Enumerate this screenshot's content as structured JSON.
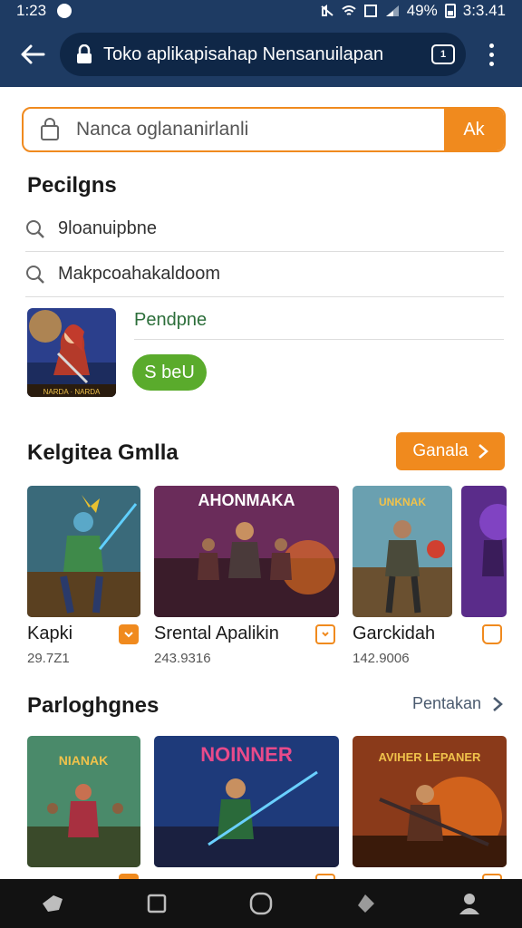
{
  "status_bar": {
    "time": "1:23",
    "battery": "49%",
    "clock": "3:3.41"
  },
  "browser": {
    "url_title": "Toko aplikapisahap Nensanuilapan",
    "tab_count": "1"
  },
  "search": {
    "placeholder": "Nanca oglananirlanli",
    "button_label": "Ak"
  },
  "suggestions": {
    "title": "Pecilgns",
    "items": [
      {
        "label": "9loanuipbne"
      },
      {
        "label": "Makpcoahakaldoom"
      }
    ],
    "featured": {
      "name": "Pendpne",
      "button_label": "S beU",
      "thumb_text": "NARDA · NARDA"
    }
  },
  "categories": {
    "title": "Kelgitea Gmlla",
    "see_all": "Ganala",
    "cards": [
      {
        "name": "Kapki",
        "meta": "29.7Z1",
        "badge": "filled"
      },
      {
        "name": "Srental Apalikin",
        "meta": "243.9316",
        "banner": "AHONMAKA",
        "badge": "outline"
      },
      {
        "name": "Garckidah",
        "meta": "142.9006",
        "banner": "UNKNAK",
        "badge": "outline-round"
      }
    ]
  },
  "popular": {
    "title": "Parloghgnes",
    "link": "Pentakan",
    "cards": [
      {
        "banner": "NIANAK"
      },
      {
        "banner": "NOINNER"
      },
      {
        "banner": "AVIHER LEPANER"
      }
    ]
  },
  "colors": {
    "accent": "#f08a1e",
    "header": "#1e3b63",
    "green": "#5aab2c"
  }
}
